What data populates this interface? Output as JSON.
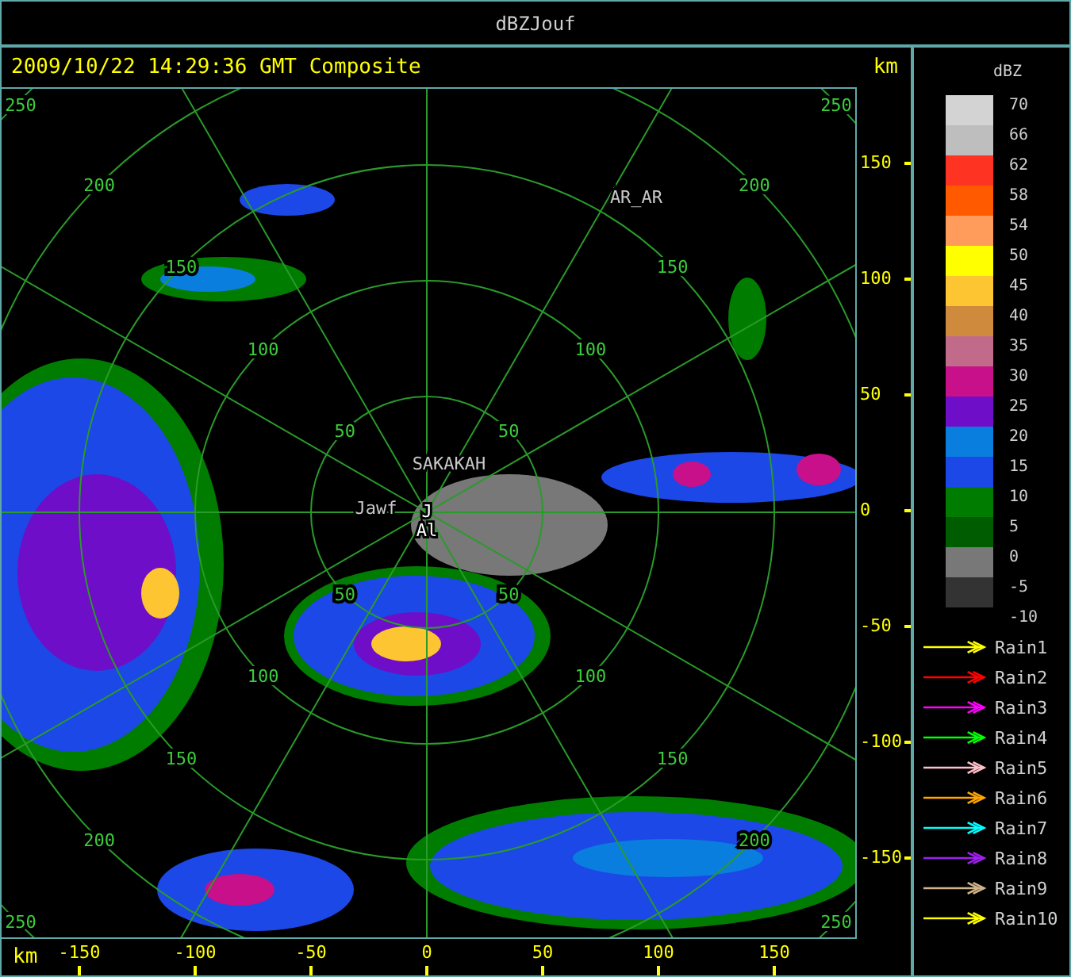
{
  "window": {
    "title": "dBZJouf"
  },
  "header": {
    "timestamp": "2009/10/22 14:29:36 GMT Composite",
    "unit": "km"
  },
  "range_rings": [
    {
      "labels": [
        "50",
        "50",
        "50",
        "50"
      ]
    },
    {
      "labels": [
        "100",
        "100",
        "100",
        "100"
      ]
    },
    {
      "labels": [
        "150",
        "150",
        "150",
        "150"
      ]
    },
    {
      "labels": [
        "200",
        "200",
        "200",
        "200"
      ]
    },
    {
      "labels": [
        "250",
        "250",
        "250",
        "250"
      ]
    }
  ],
  "sites": [
    {
      "label": "SAKAKAH",
      "kind": "town"
    },
    {
      "label": "Jawf",
      "kind": "town"
    },
    {
      "label": "AR_AR",
      "kind": "town"
    },
    {
      "label": "J",
      "kind": "radar"
    },
    {
      "label": "Al",
      "kind": "radar"
    }
  ],
  "y_axis": {
    "ticks": [
      "150",
      "100",
      "50",
      "0",
      "-50",
      "-100",
      "-150"
    ]
  },
  "x_axis": {
    "unit": "km",
    "ticks": [
      "-150",
      "-100",
      "-50",
      "0",
      "50",
      "100",
      "150"
    ]
  },
  "legend": {
    "title": "dBZ",
    "bands": [
      {
        "color": "#d3d3d3"
      },
      {
        "color": "#bebebe"
      },
      {
        "color": "#ff3322"
      },
      {
        "color": "#ff5a00"
      },
      {
        "color": "#ff9c5c"
      },
      {
        "color": "#ffff00"
      },
      {
        "color": "#fcc531"
      },
      {
        "color": "#d08a3d"
      },
      {
        "color": "#c26a8a"
      },
      {
        "color": "#c8108a"
      },
      {
        "color": "#6e0ec8"
      },
      {
        "color": "#0a7ede"
      },
      {
        "color": "#1c48e8"
      },
      {
        "color": "#007d00"
      },
      {
        "color": "#005c00"
      },
      {
        "color": "#787878"
      },
      {
        "color": "#333333"
      }
    ],
    "labels": [
      "70",
      "66",
      "62",
      "58",
      "54",
      "50",
      "45",
      "40",
      "35",
      "30",
      "25",
      "20",
      "15",
      "10",
      "5",
      "0",
      "-5",
      "-10"
    ]
  },
  "tracks": [
    {
      "label": "Rain1",
      "color": "#ffff00"
    },
    {
      "label": "Rain2",
      "color": "#ff0000"
    },
    {
      "label": "Rain3",
      "color": "#ff00ff"
    },
    {
      "label": "Rain4",
      "color": "#00ff00"
    },
    {
      "label": "Rain5",
      "color": "#ffc0cb"
    },
    {
      "label": "Rain6",
      "color": "#ffa500"
    },
    {
      "label": "Rain7",
      "color": "#00ffff"
    },
    {
      "label": "Rain8",
      "color": "#a020f0"
    },
    {
      "label": "Rain9",
      "color": "#d2b48c"
    },
    {
      "label": "Rain10",
      "color": "#ffff00"
    }
  ]
}
